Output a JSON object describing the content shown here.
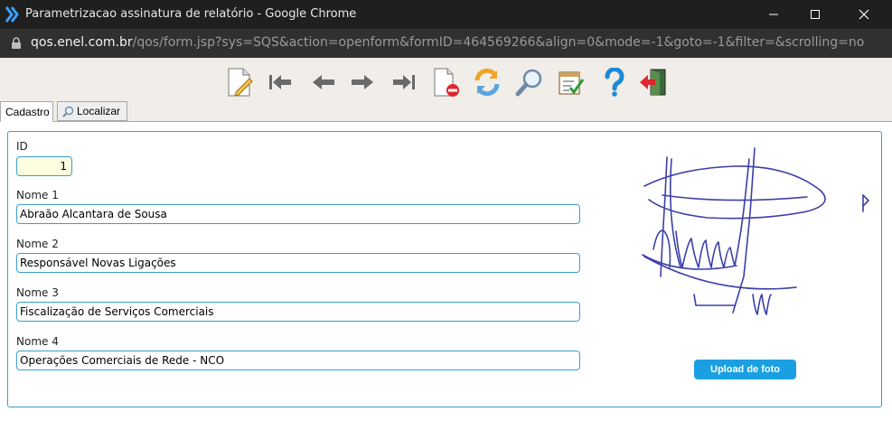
{
  "window": {
    "title": "Parametrizacao assinatura de relatório - Google Chrome",
    "url_domain": "qos.enel.com.br",
    "url_path": "/qos/form.jsp?sys=SQS&action=openform&formID=464569266&align=0&mode=-1&goto=-1&filter=&scrolling=no"
  },
  "toolbar": {
    "buttons": [
      "new-record",
      "first-record",
      "previous-record",
      "next-record",
      "last-record",
      "delete-record",
      "refresh",
      "search",
      "edit-list",
      "help",
      "exit"
    ]
  },
  "tabs": [
    {
      "label": "Cadastro",
      "active": true
    },
    {
      "label": "Localizar",
      "active": false
    }
  ],
  "form": {
    "id_label": "ID",
    "id_value": "1",
    "nome1_label": "Nome 1",
    "nome1_value": "Abraão Alcantara de Sousa",
    "nome2_label": "Nome 2",
    "nome2_value": "Responsável Novas Ligações",
    "nome3_label": "Nome 3",
    "nome3_value": "Fiscalização de Serviços Comerciais",
    "nome4_label": "Nome 4",
    "nome4_value": "Operações Comerciais de Rede - NCO",
    "upload_label": "Upload de foto"
  },
  "colors": {
    "field_border": "#3a9ec9",
    "upload_button": "#1aa0e2",
    "signature_ink": "#3b3fa8"
  }
}
